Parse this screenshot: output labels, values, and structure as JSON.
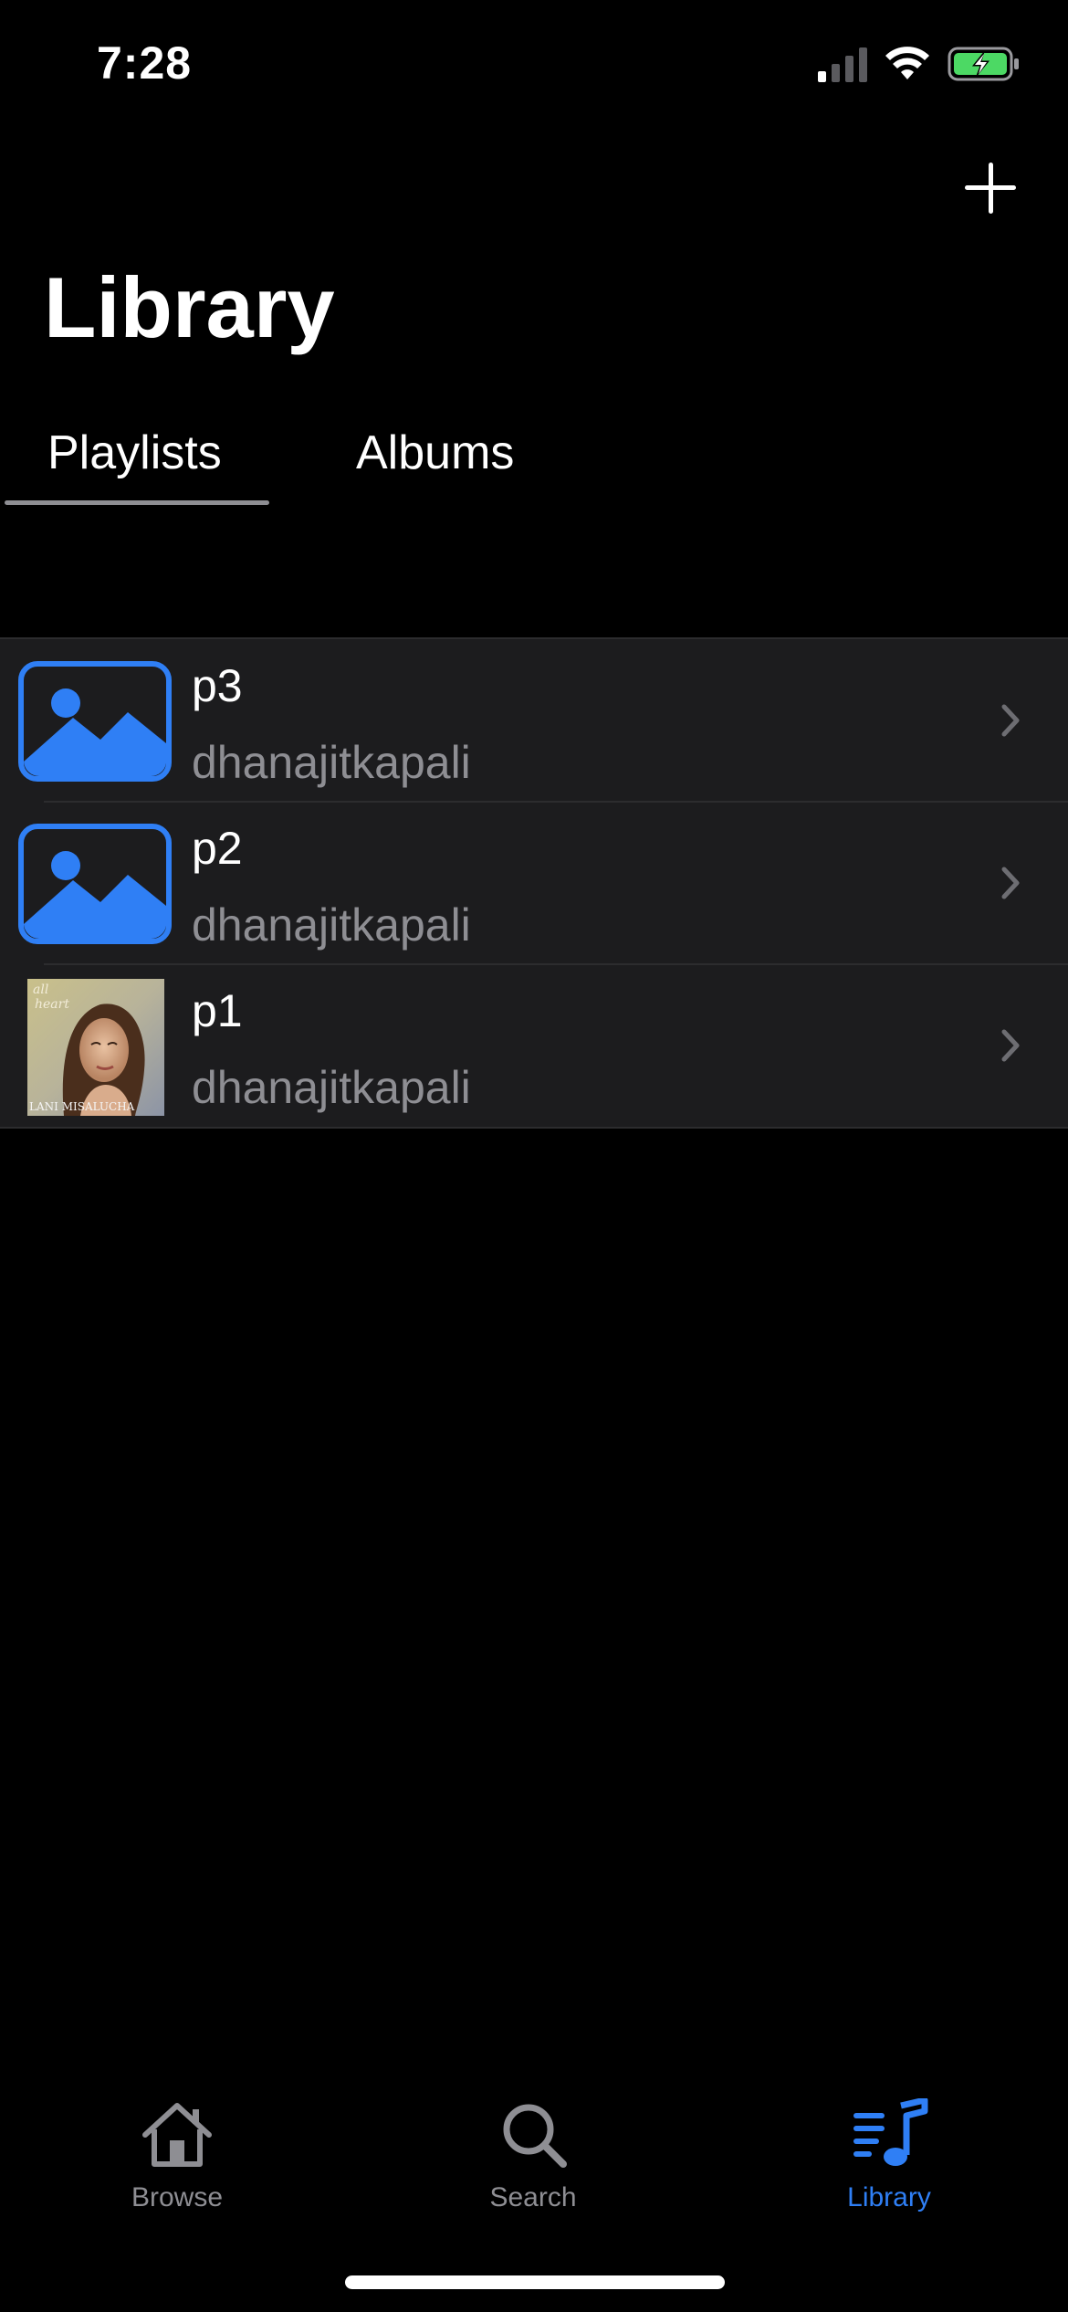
{
  "status_bar": {
    "time": "7:28"
  },
  "header": {
    "title": "Library"
  },
  "tabs": [
    {
      "label": "Playlists",
      "active": true
    },
    {
      "label": "Albums",
      "active": false
    }
  ],
  "playlists": [
    {
      "title": "p3",
      "owner": "dhanajitkapali",
      "artwork": "placeholder-image-icon"
    },
    {
      "title": "p2",
      "owner": "dhanajitkapali",
      "artwork": "placeholder-image-icon"
    },
    {
      "title": "p1",
      "owner": "dhanajitkapali",
      "artwork": "album-cover-photo",
      "artwork_text": [
        "all heart",
        "LANI MISALUCHA"
      ]
    }
  ],
  "tab_bar": {
    "items": [
      {
        "label": "Browse",
        "icon": "house-icon",
        "active": false
      },
      {
        "label": "Search",
        "icon": "magnifying-glass-icon",
        "active": false
      },
      {
        "label": "Library",
        "icon": "music-library-icon",
        "active": true
      }
    ]
  },
  "colors": {
    "background": "#000000",
    "row_background": "#1c1c1e",
    "accent": "#2f7ff5",
    "secondary_text": "#8e8e93",
    "battery_fill": "#4cd964"
  }
}
